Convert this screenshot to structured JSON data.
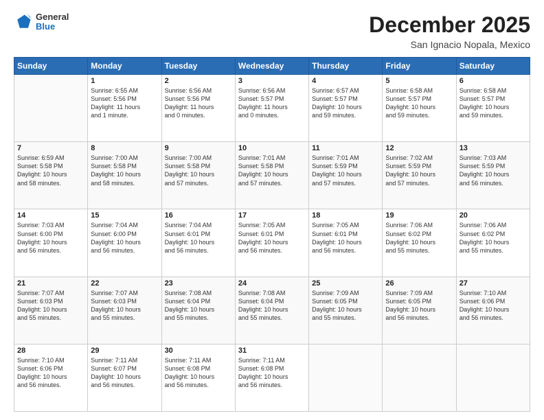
{
  "header": {
    "logo": {
      "general": "General",
      "blue": "Blue"
    },
    "title": "December 2025",
    "subtitle": "San Ignacio Nopala, Mexico"
  },
  "calendar": {
    "days_of_week": [
      "Sunday",
      "Monday",
      "Tuesday",
      "Wednesday",
      "Thursday",
      "Friday",
      "Saturday"
    ],
    "weeks": [
      [
        {
          "num": "",
          "info": ""
        },
        {
          "num": "1",
          "info": "Sunrise: 6:55 AM\nSunset: 5:56 PM\nDaylight: 11 hours\nand 1 minute."
        },
        {
          "num": "2",
          "info": "Sunrise: 6:56 AM\nSunset: 5:56 PM\nDaylight: 11 hours\nand 0 minutes."
        },
        {
          "num": "3",
          "info": "Sunrise: 6:56 AM\nSunset: 5:57 PM\nDaylight: 11 hours\nand 0 minutes."
        },
        {
          "num": "4",
          "info": "Sunrise: 6:57 AM\nSunset: 5:57 PM\nDaylight: 10 hours\nand 59 minutes."
        },
        {
          "num": "5",
          "info": "Sunrise: 6:58 AM\nSunset: 5:57 PM\nDaylight: 10 hours\nand 59 minutes."
        },
        {
          "num": "6",
          "info": "Sunrise: 6:58 AM\nSunset: 5:57 PM\nDaylight: 10 hours\nand 59 minutes."
        }
      ],
      [
        {
          "num": "7",
          "info": "Sunrise: 6:59 AM\nSunset: 5:58 PM\nDaylight: 10 hours\nand 58 minutes."
        },
        {
          "num": "8",
          "info": "Sunrise: 7:00 AM\nSunset: 5:58 PM\nDaylight: 10 hours\nand 58 minutes."
        },
        {
          "num": "9",
          "info": "Sunrise: 7:00 AM\nSunset: 5:58 PM\nDaylight: 10 hours\nand 57 minutes."
        },
        {
          "num": "10",
          "info": "Sunrise: 7:01 AM\nSunset: 5:58 PM\nDaylight: 10 hours\nand 57 minutes."
        },
        {
          "num": "11",
          "info": "Sunrise: 7:01 AM\nSunset: 5:59 PM\nDaylight: 10 hours\nand 57 minutes."
        },
        {
          "num": "12",
          "info": "Sunrise: 7:02 AM\nSunset: 5:59 PM\nDaylight: 10 hours\nand 57 minutes."
        },
        {
          "num": "13",
          "info": "Sunrise: 7:03 AM\nSunset: 5:59 PM\nDaylight: 10 hours\nand 56 minutes."
        }
      ],
      [
        {
          "num": "14",
          "info": "Sunrise: 7:03 AM\nSunset: 6:00 PM\nDaylight: 10 hours\nand 56 minutes."
        },
        {
          "num": "15",
          "info": "Sunrise: 7:04 AM\nSunset: 6:00 PM\nDaylight: 10 hours\nand 56 minutes."
        },
        {
          "num": "16",
          "info": "Sunrise: 7:04 AM\nSunset: 6:01 PM\nDaylight: 10 hours\nand 56 minutes."
        },
        {
          "num": "17",
          "info": "Sunrise: 7:05 AM\nSunset: 6:01 PM\nDaylight: 10 hours\nand 56 minutes."
        },
        {
          "num": "18",
          "info": "Sunrise: 7:05 AM\nSunset: 6:01 PM\nDaylight: 10 hours\nand 56 minutes."
        },
        {
          "num": "19",
          "info": "Sunrise: 7:06 AM\nSunset: 6:02 PM\nDaylight: 10 hours\nand 55 minutes."
        },
        {
          "num": "20",
          "info": "Sunrise: 7:06 AM\nSunset: 6:02 PM\nDaylight: 10 hours\nand 55 minutes."
        }
      ],
      [
        {
          "num": "21",
          "info": "Sunrise: 7:07 AM\nSunset: 6:03 PM\nDaylight: 10 hours\nand 55 minutes."
        },
        {
          "num": "22",
          "info": "Sunrise: 7:07 AM\nSunset: 6:03 PM\nDaylight: 10 hours\nand 55 minutes."
        },
        {
          "num": "23",
          "info": "Sunrise: 7:08 AM\nSunset: 6:04 PM\nDaylight: 10 hours\nand 55 minutes."
        },
        {
          "num": "24",
          "info": "Sunrise: 7:08 AM\nSunset: 6:04 PM\nDaylight: 10 hours\nand 55 minutes."
        },
        {
          "num": "25",
          "info": "Sunrise: 7:09 AM\nSunset: 6:05 PM\nDaylight: 10 hours\nand 55 minutes."
        },
        {
          "num": "26",
          "info": "Sunrise: 7:09 AM\nSunset: 6:05 PM\nDaylight: 10 hours\nand 56 minutes."
        },
        {
          "num": "27",
          "info": "Sunrise: 7:10 AM\nSunset: 6:06 PM\nDaylight: 10 hours\nand 56 minutes."
        }
      ],
      [
        {
          "num": "28",
          "info": "Sunrise: 7:10 AM\nSunset: 6:06 PM\nDaylight: 10 hours\nand 56 minutes."
        },
        {
          "num": "29",
          "info": "Sunrise: 7:11 AM\nSunset: 6:07 PM\nDaylight: 10 hours\nand 56 minutes."
        },
        {
          "num": "30",
          "info": "Sunrise: 7:11 AM\nSunset: 6:08 PM\nDaylight: 10 hours\nand 56 minutes."
        },
        {
          "num": "31",
          "info": "Sunrise: 7:11 AM\nSunset: 6:08 PM\nDaylight: 10 hours\nand 56 minutes."
        },
        {
          "num": "",
          "info": ""
        },
        {
          "num": "",
          "info": ""
        },
        {
          "num": "",
          "info": ""
        }
      ]
    ]
  }
}
